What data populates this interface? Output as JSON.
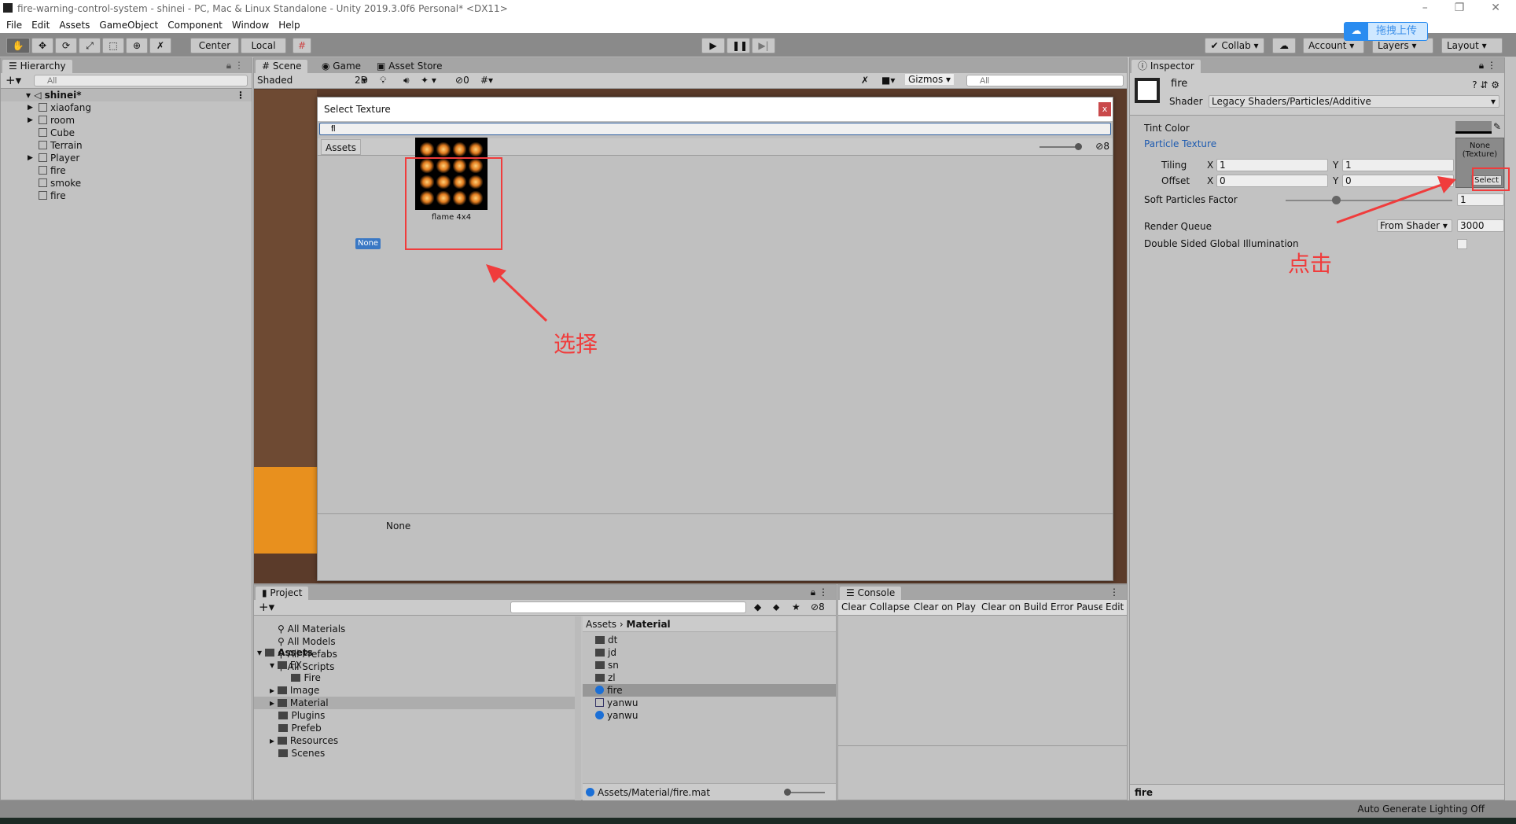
{
  "window": {
    "title": "fire-warning-control-system - shinei - PC, Mac & Linux Standalone - Unity 2019.3.0f6 Personal* <DX11>"
  },
  "menu": [
    "File",
    "Edit",
    "Assets",
    "GameObject",
    "Component",
    "Window",
    "Help"
  ],
  "toolbar": {
    "center": "Center",
    "local": "Local",
    "collab": "Collab",
    "account": "Account",
    "layers": "Layers",
    "layout": "Layout",
    "upload_badge": "拖拽上传"
  },
  "hierarchy": {
    "tab": "Hierarchy",
    "search_placeholder": "All",
    "scene": "shinei*",
    "items": [
      {
        "label": "xiaofang",
        "expandable": true
      },
      {
        "label": "room",
        "expandable": true
      },
      {
        "label": "Cube",
        "expandable": false
      },
      {
        "label": "Terrain",
        "expandable": false
      },
      {
        "label": "Player",
        "expandable": true
      },
      {
        "label": "fire",
        "expandable": false
      },
      {
        "label": "smoke",
        "expandable": false
      },
      {
        "label": "fire",
        "expandable": false
      }
    ]
  },
  "scene": {
    "tabs": [
      "Scene",
      "Game",
      "Asset Store"
    ],
    "shading": "Shaded",
    "mode2d": "2D",
    "hidden_count": "0",
    "gizmos": "Gizmos",
    "search_placeholder": "All"
  },
  "dialog": {
    "title": "Select Texture",
    "close": "x",
    "search_value": "fl",
    "tab": "Assets",
    "hidden_count": "8",
    "none_label": "None",
    "asset": "flame 4x4",
    "preview_label": "None"
  },
  "annotations": {
    "select_text": "选择",
    "click_text": "点击",
    "color": "#f03c3c"
  },
  "inspector": {
    "tab": "Inspector",
    "name": "fire",
    "shader_label": "Shader",
    "shader": "Legacy Shaders/Particles/Additive",
    "tint": "Tint Color",
    "texture": "Particle Texture",
    "texture_slot": "None\n(Texture)",
    "select": "Select",
    "tiling": "Tiling",
    "offset": "Offset",
    "tiling_x": "1",
    "tiling_y": "1",
    "offset_x": "0",
    "offset_y": "0",
    "x": "X",
    "y": "Y",
    "soft": "Soft Particles Factor",
    "soft_value": "1",
    "soft_fraction": 0.3,
    "queue": "Render Queue",
    "queue_mode": "From Shader",
    "queue_value": "3000",
    "dsgi": "Double Sided Global Illumination",
    "footer": "fire"
  },
  "project": {
    "tab": "Project",
    "favorites": [
      "All Materials",
      "All Models",
      "All Prefabs",
      "All Scripts"
    ],
    "assets_root": "Assets",
    "tree": [
      {
        "label": "FX",
        "indent": 1,
        "open": true
      },
      {
        "label": "Fire",
        "indent": 2
      },
      {
        "label": "Image",
        "indent": 1,
        "expandable": true
      },
      {
        "label": "Material",
        "indent": 1,
        "expandable": true,
        "selected": true
      },
      {
        "label": "Plugins",
        "indent": 1
      },
      {
        "label": "Prefeb",
        "indent": 1
      },
      {
        "label": "Resources",
        "indent": 1,
        "expandable": true
      },
      {
        "label": "Scenes",
        "indent": 1
      }
    ],
    "breadcrumb": [
      "Assets",
      "Material"
    ],
    "files": [
      {
        "label": "dt",
        "type": "folder"
      },
      {
        "label": "jd",
        "type": "folder"
      },
      {
        "label": "sn",
        "type": "folder"
      },
      {
        "label": "zl",
        "type": "folder"
      },
      {
        "label": "fire",
        "type": "material",
        "selected": true
      },
      {
        "label": "yanwu",
        "type": "texture"
      },
      {
        "label": "yanwu",
        "type": "material"
      }
    ],
    "path": "Assets/Material/fire.mat",
    "hidden_count": "8"
  },
  "console": {
    "tab": "Console",
    "buttons": [
      "Clear",
      "Collapse",
      "Clear on Play",
      "Clear on Build",
      "Error Pause",
      "Edit"
    ]
  },
  "status": {
    "text": "Auto Generate Lighting Off"
  }
}
